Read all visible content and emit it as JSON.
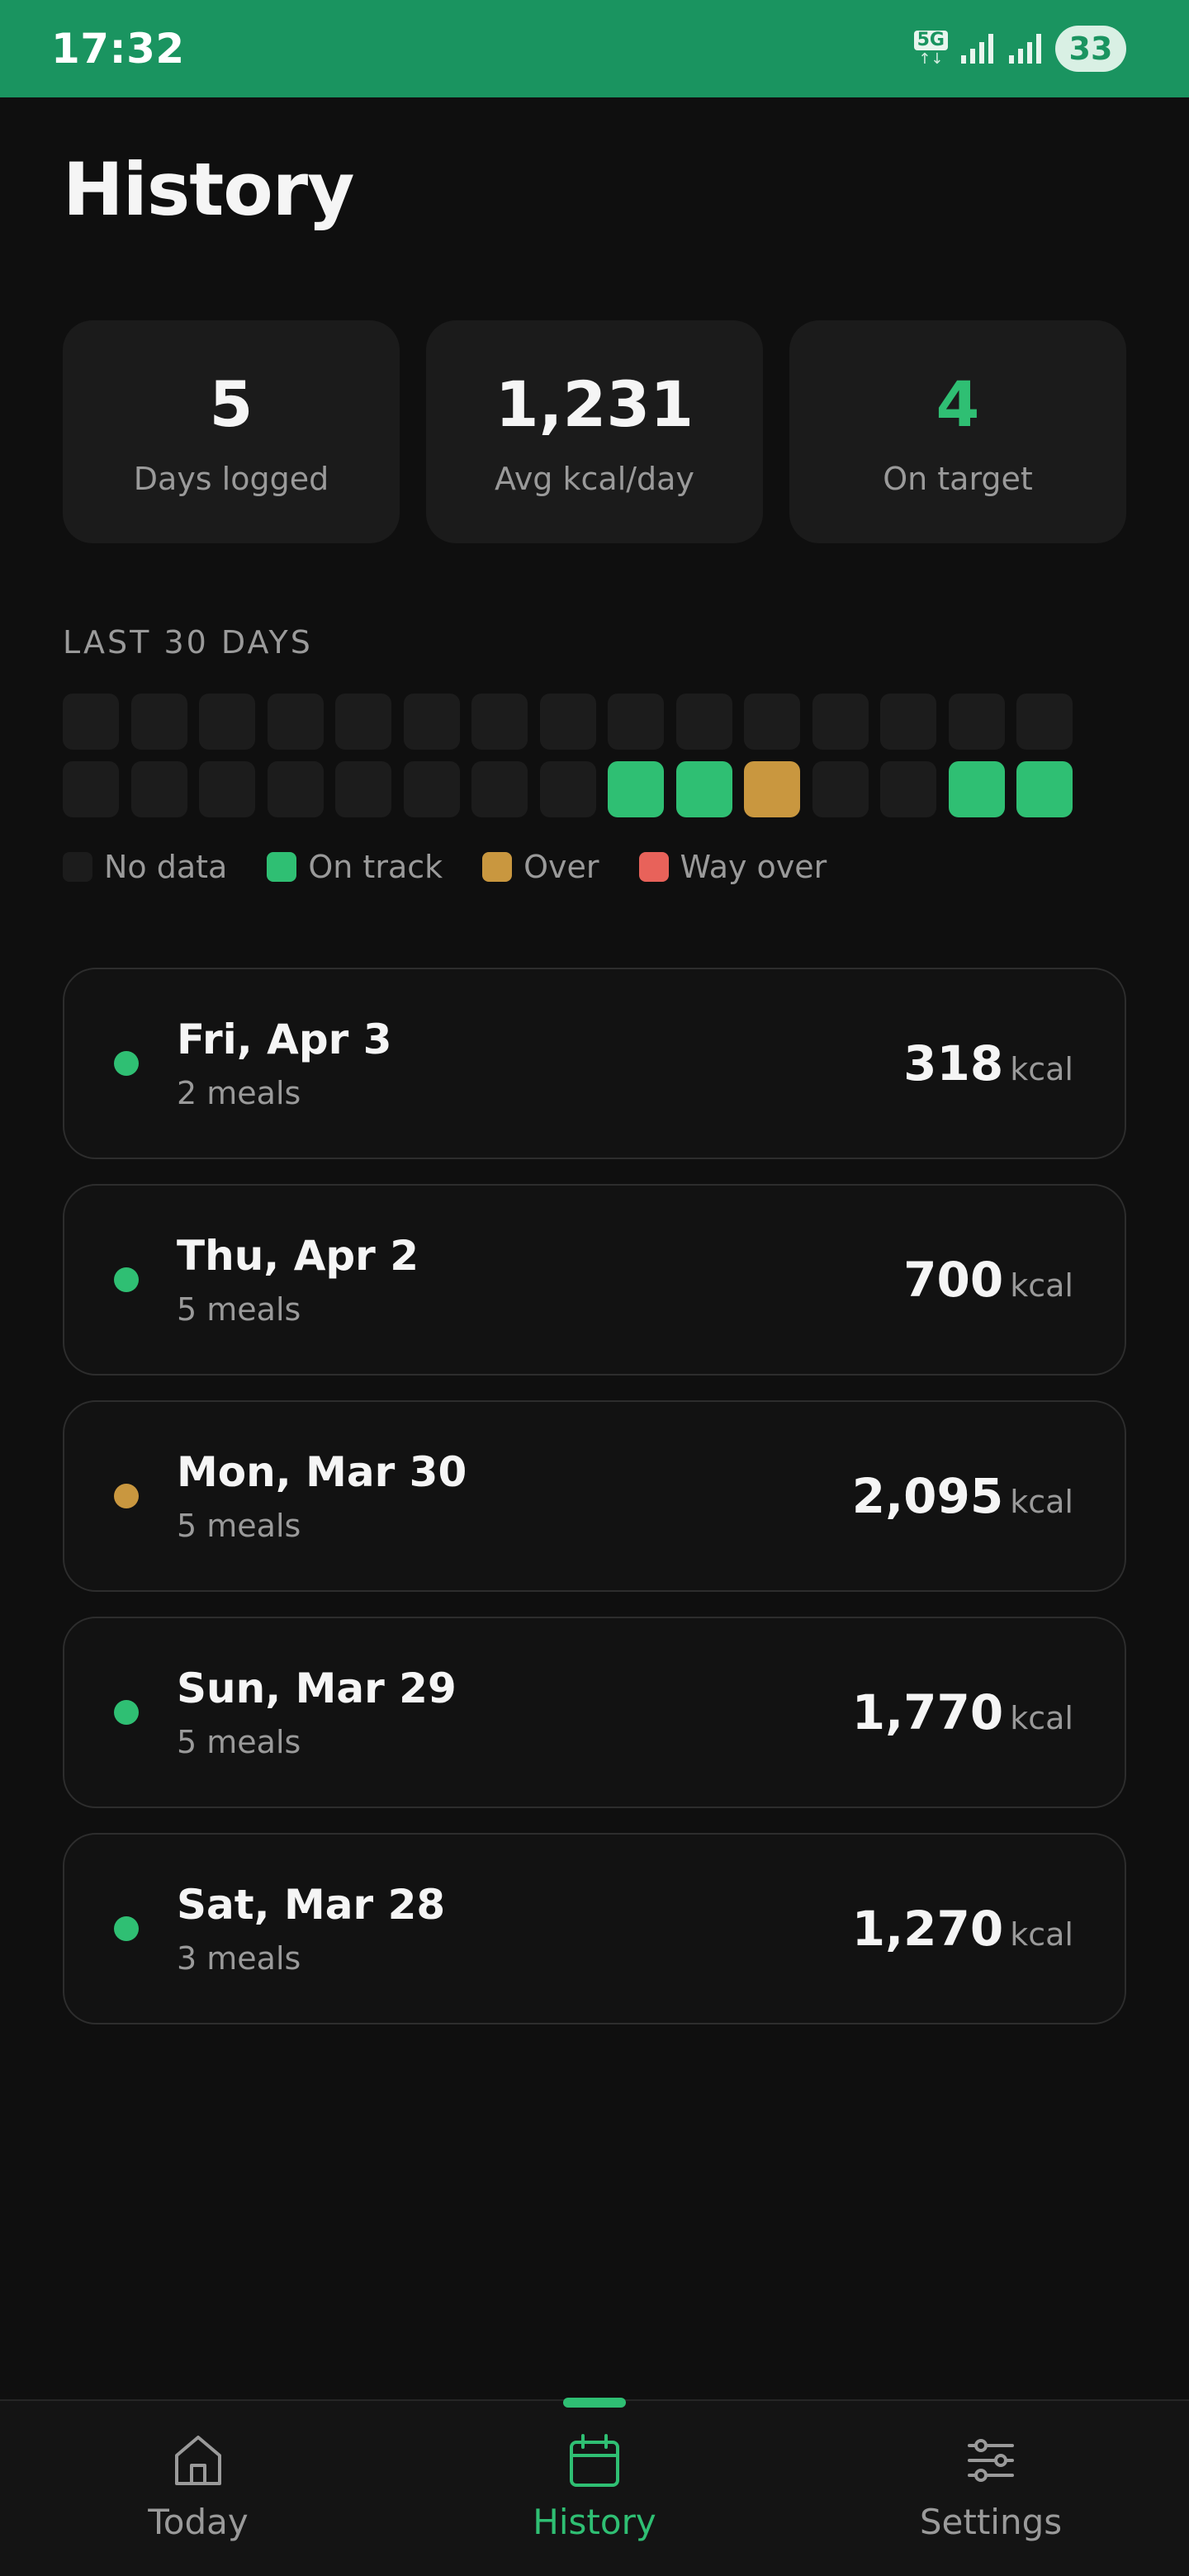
{
  "status_bar": {
    "time": "17:32",
    "network": "5G",
    "network_arrows": "↑↓",
    "battery": "33"
  },
  "page": {
    "title": "History"
  },
  "stats": [
    {
      "value": "5",
      "label": "Days logged",
      "accent": false
    },
    {
      "value": "1,231",
      "label": "Avg kcal/day",
      "accent": false
    },
    {
      "value": "4",
      "label": "On target",
      "accent": true
    }
  ],
  "calendar": {
    "heading": "LAST 30 DAYS",
    "cells": [
      "no_data",
      "no_data",
      "no_data",
      "no_data",
      "no_data",
      "no_data",
      "no_data",
      "no_data",
      "no_data",
      "no_data",
      "no_data",
      "no_data",
      "no_data",
      "no_data",
      "no_data",
      "no_data",
      "no_data",
      "no_data",
      "no_data",
      "no_data",
      "no_data",
      "no_data",
      "no_data",
      "on_track",
      "on_track",
      "over",
      "no_data",
      "no_data",
      "on_track",
      "on_track"
    ],
    "legend": [
      {
        "key": "no_data",
        "label": "No data",
        "color": "#1c1c1c"
      },
      {
        "key": "on_track",
        "label": "On track",
        "color": "#2fbf73"
      },
      {
        "key": "over",
        "label": "Over",
        "color": "#c9973f"
      },
      {
        "key": "way_over",
        "label": "Way over",
        "color": "#e8625a"
      }
    ]
  },
  "days": [
    {
      "date": "Fri, Apr 3",
      "meals": "2 meals",
      "kcal": "318",
      "unit": "kcal",
      "status": "on_track"
    },
    {
      "date": "Thu, Apr 2",
      "meals": "5 meals",
      "kcal": "700",
      "unit": "kcal",
      "status": "on_track"
    },
    {
      "date": "Mon, Mar 30",
      "meals": "5 meals",
      "kcal": "2,095",
      "unit": "kcal",
      "status": "over"
    },
    {
      "date": "Sun, Mar 29",
      "meals": "5 meals",
      "kcal": "1,770",
      "unit": "kcal",
      "status": "on_track"
    },
    {
      "date": "Sat, Mar 28",
      "meals": "3 meals",
      "kcal": "1,270",
      "unit": "kcal",
      "status": "on_track"
    }
  ],
  "colors": {
    "on_track": "#2fbf73",
    "over": "#c9973f",
    "way_over": "#e8625a",
    "no_data": "#1c1c1c",
    "status_bar": "#1a9460"
  },
  "nav": [
    {
      "label": "Today",
      "icon": "home-icon",
      "active": false
    },
    {
      "label": "History",
      "icon": "calendar-icon",
      "active": true
    },
    {
      "label": "Settings",
      "icon": "sliders-icon",
      "active": false
    }
  ]
}
